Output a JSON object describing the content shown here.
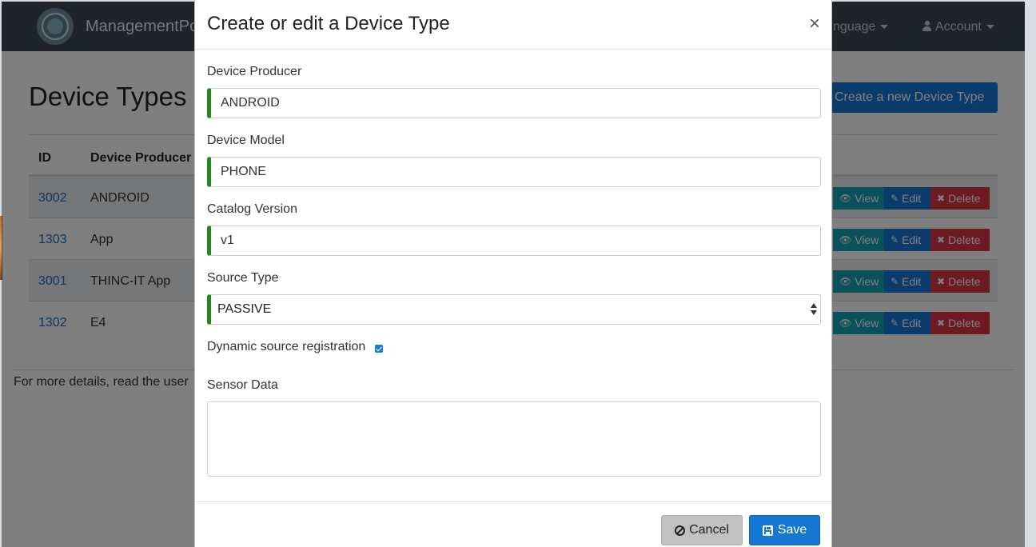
{
  "navbar": {
    "brand": "ManagementPo",
    "language": "nguage",
    "account": "Account"
  },
  "page": {
    "title": "Device Types",
    "create_button": "Create a new Device Type",
    "table": {
      "headers": [
        "ID",
        "Device Producer"
      ],
      "rows": [
        {
          "id": "3002",
          "producer": "ANDROID"
        },
        {
          "id": "1303",
          "producer": "App"
        },
        {
          "id": "3001",
          "producer": "THINC-IT App"
        },
        {
          "id": "1302",
          "producer": "E4"
        }
      ],
      "actions": {
        "view": "View",
        "edit": "Edit",
        "delete": "Delete"
      }
    },
    "footer_text": "For more details, read the user"
  },
  "modal": {
    "title": "Create or edit a Device Type",
    "close": "×",
    "fields": {
      "producer": {
        "label": "Device Producer",
        "value": "ANDROID"
      },
      "model": {
        "label": "Device Model",
        "value": "PHONE"
      },
      "catalog": {
        "label": "Catalog Version",
        "value": "v1"
      },
      "source_type": {
        "label": "Source Type",
        "value": "PASSIVE"
      },
      "dynamic": {
        "label": "Dynamic source registration",
        "checked": true
      },
      "sensor": {
        "label": "Sensor Data",
        "value": ""
      }
    },
    "buttons": {
      "cancel": "Cancel",
      "save": "Save"
    }
  },
  "colors": {
    "navbar": "#3d4952",
    "primary": "#1477d4",
    "valid_border": "#1e8a1e",
    "view": "#17a2b8",
    "delete": "#dc3545",
    "cancel": "#c1c1c1"
  }
}
